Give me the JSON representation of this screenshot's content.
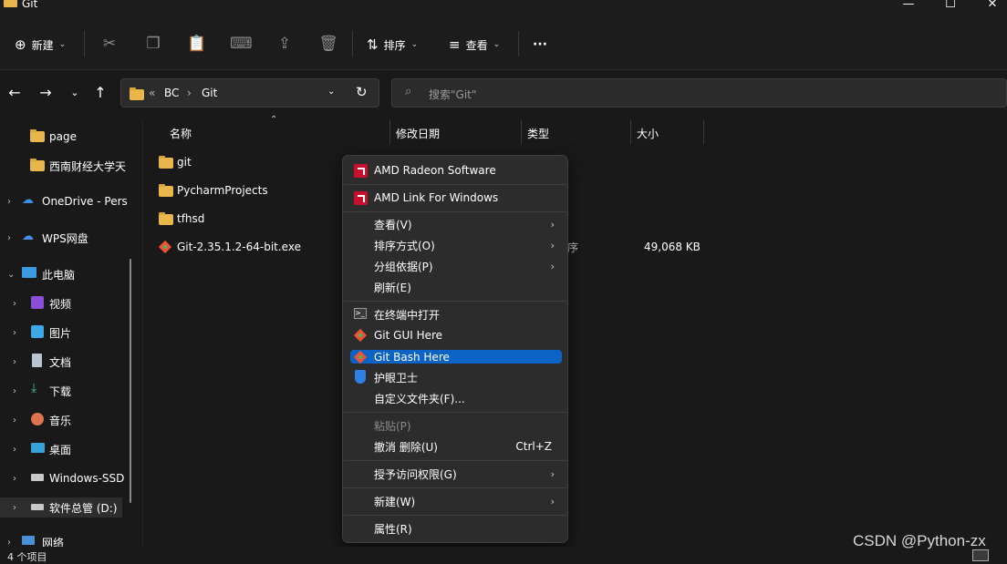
{
  "window": {
    "title": "Git",
    "minimize": "—",
    "maximize": "☐",
    "close": "✕"
  },
  "toolbar": {
    "new_label": "新建",
    "sort_label": "排序",
    "view_label": "查看",
    "more_label": "···"
  },
  "nav": {
    "breadcrumb": [
      "«",
      "BC",
      "›",
      "Git"
    ],
    "search_placeholder": "搜索\"Git\""
  },
  "sidebar": {
    "items": [
      {
        "label": "page",
        "icon": "folder-icon"
      },
      {
        "label": "西南财经大学天",
        "icon": "folder-icon"
      },
      {
        "label": "OneDrive - Pers",
        "icon": "cloud-icon"
      },
      {
        "label": "WPS网盘",
        "icon": "cloud-icon"
      },
      {
        "label": "此电脑",
        "icon": "monitor-icon"
      },
      {
        "label": "视频",
        "icon": "video-icon"
      },
      {
        "label": "图片",
        "icon": "picture-icon"
      },
      {
        "label": "文档",
        "icon": "document-icon"
      },
      {
        "label": "下载",
        "icon": "download-icon"
      },
      {
        "label": "音乐",
        "icon": "music-icon"
      },
      {
        "label": "桌面",
        "icon": "desktop-icon"
      },
      {
        "label": "Windows-SSD",
        "icon": "drive-icon"
      },
      {
        "label": "软件总管 (D:)",
        "icon": "drive-icon"
      },
      {
        "label": "网络",
        "icon": "network-icon"
      }
    ]
  },
  "columns": [
    "名称",
    "修改日期",
    "类型",
    "大小"
  ],
  "files": [
    {
      "name": "git",
      "icon": "folder-icon",
      "size": ""
    },
    {
      "name": "PycharmProjects",
      "icon": "folder-icon",
      "size": ""
    },
    {
      "name": "tfhsd",
      "icon": "folder-icon",
      "size": ""
    },
    {
      "name": "Git-2.35.1.2-64-bit.exe",
      "icon": "git-installer-icon",
      "type_fragment": "序",
      "size": "49,068 KB"
    }
  ],
  "context_menu": {
    "amd_software": "AMD Radeon Software",
    "amd_link": "AMD Link For Windows",
    "view": "查看(V)",
    "sort_by": "排序方式(O)",
    "group_by": "分组依据(P)",
    "refresh": "刷新(E)",
    "open_terminal": "在终端中打开",
    "git_gui": "Git GUI Here",
    "git_bash": "Git Bash Here",
    "eye_guard": "护眼卫士",
    "customize_folder": "自定义文件夹(F)...",
    "paste": "粘贴(P)",
    "undo_delete": "撤消 删除(U)",
    "undo_shortcut": "Ctrl+Z",
    "grant_access": "授予访问权限(G)",
    "new": "新建(W)",
    "properties": "属性(R)"
  },
  "status": {
    "item_count": "4 个项目"
  },
  "watermark": "CSDN @Python-zx",
  "colors": {
    "folder": "#e8b64a",
    "highlight": "#0c63c6",
    "amd_red": "#c8102e"
  }
}
